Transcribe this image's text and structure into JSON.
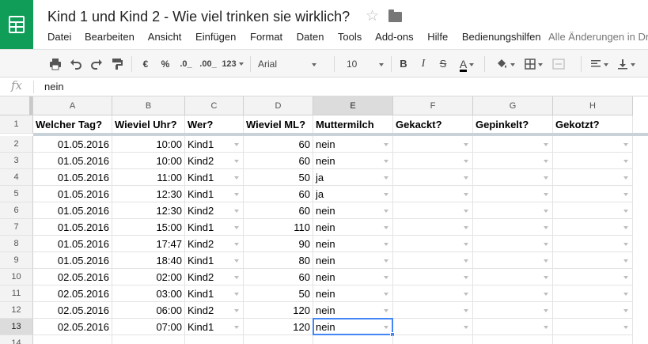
{
  "app": {
    "title": "Kind 1 und Kind 2 - Wie viel trinken sie wirklich?",
    "save_status": "Alle Änderungen in Dr",
    "menu": [
      "Datei",
      "Bearbeiten",
      "Ansicht",
      "Einfügen",
      "Format",
      "Daten",
      "Tools",
      "Add-ons",
      "Hilfe",
      "Bedienungshilfen"
    ]
  },
  "toolbar": {
    "currency": "€",
    "percent": "%",
    "dec_decrease": ".0_",
    "dec_increase": ".00_",
    "number_format": "123",
    "font": "Arial",
    "font_size": "10",
    "bold": "B",
    "italic": "I",
    "strike": "S",
    "text_color": "A"
  },
  "formula_bar": {
    "fx": "fx",
    "value": "nein"
  },
  "colors": {
    "brand": "#0f9d58",
    "selection": "#4285f4"
  },
  "grid": {
    "columns": [
      "A",
      "B",
      "C",
      "D",
      "E",
      "F",
      "G",
      "H"
    ],
    "header_row": [
      "Welcher Tag?",
      "Wieviel Uhr?",
      "Wer?",
      "Wieviel ML?",
      "Muttermilch",
      "Gekackt?",
      "Gepinkelt?",
      "Gekotzt?"
    ],
    "rows": [
      [
        "01.05.2016",
        "10:00",
        "Kind1",
        "60",
        "nein",
        "",
        "",
        ""
      ],
      [
        "01.05.2016",
        "10:00",
        "Kind2",
        "60",
        "nein",
        "",
        "",
        ""
      ],
      [
        "01.05.2016",
        "11:00",
        "Kind1",
        "50",
        "ja",
        "",
        "",
        ""
      ],
      [
        "01.05.2016",
        "12:30",
        "Kind1",
        "60",
        "ja",
        "",
        "",
        ""
      ],
      [
        "01.05.2016",
        "12:30",
        "Kind2",
        "60",
        "nein",
        "",
        "",
        ""
      ],
      [
        "01.05.2016",
        "15:00",
        "Kind1",
        "110",
        "nein",
        "",
        "",
        ""
      ],
      [
        "01.05.2016",
        "17:47",
        "Kind2",
        "90",
        "nein",
        "",
        "",
        ""
      ],
      [
        "01.05.2016",
        "18:40",
        "Kind1",
        "80",
        "nein",
        "",
        "",
        ""
      ],
      [
        "02.05.2016",
        "02:00",
        "Kind2",
        "60",
        "nein",
        "",
        "",
        ""
      ],
      [
        "02.05.2016",
        "03:00",
        "Kind1",
        "50",
        "nein",
        "",
        "",
        ""
      ],
      [
        "02.05.2016",
        "06:00",
        "Kind2",
        "120",
        "nein",
        "",
        "",
        ""
      ],
      [
        "02.05.2016",
        "07:00",
        "Kind1",
        "120",
        "nein",
        "",
        "",
        ""
      ],
      [
        "",
        "",
        "",
        "",
        "",
        "",
        "",
        ""
      ]
    ],
    "row_numbers": [
      "1",
      "2",
      "3",
      "4",
      "5",
      "6",
      "7",
      "8",
      "9",
      "10",
      "11",
      "12",
      "13",
      "14"
    ],
    "selected_cell": "E13"
  }
}
